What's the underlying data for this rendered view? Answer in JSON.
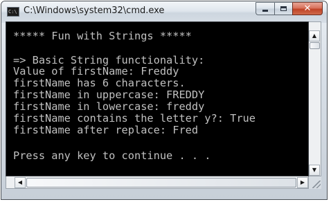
{
  "window": {
    "title": "C:\\Windows\\system32\\cmd.exe",
    "icon_label": "C:\\"
  },
  "console": {
    "lines": [
      "***** Fun with Strings *****",
      "",
      "=> Basic String functionality:",
      "Value of firstName: Freddy",
      "firstName has 6 characters.",
      "firstName in uppercase: FREDDY",
      "firstName in lowercase: freddy",
      "firstName contains the letter y?: True",
      "firstName after replace: Fred",
      "",
      "Press any key to continue . . ."
    ],
    "text_color": "#c0c0c0",
    "background_color": "#000000"
  },
  "icons": {
    "minimize": "minimize-icon",
    "maximize": "maximize-icon",
    "close": "close-icon",
    "scroll_up": "arrow-up-icon",
    "scroll_down": "arrow-down-icon",
    "scroll_left": "arrow-left-icon",
    "scroll_right": "arrow-right-icon",
    "resize_grip": "resize-grip-icon"
  },
  "colors": {
    "close_button": "#c04326",
    "titlebar": "#dfe6ed"
  }
}
